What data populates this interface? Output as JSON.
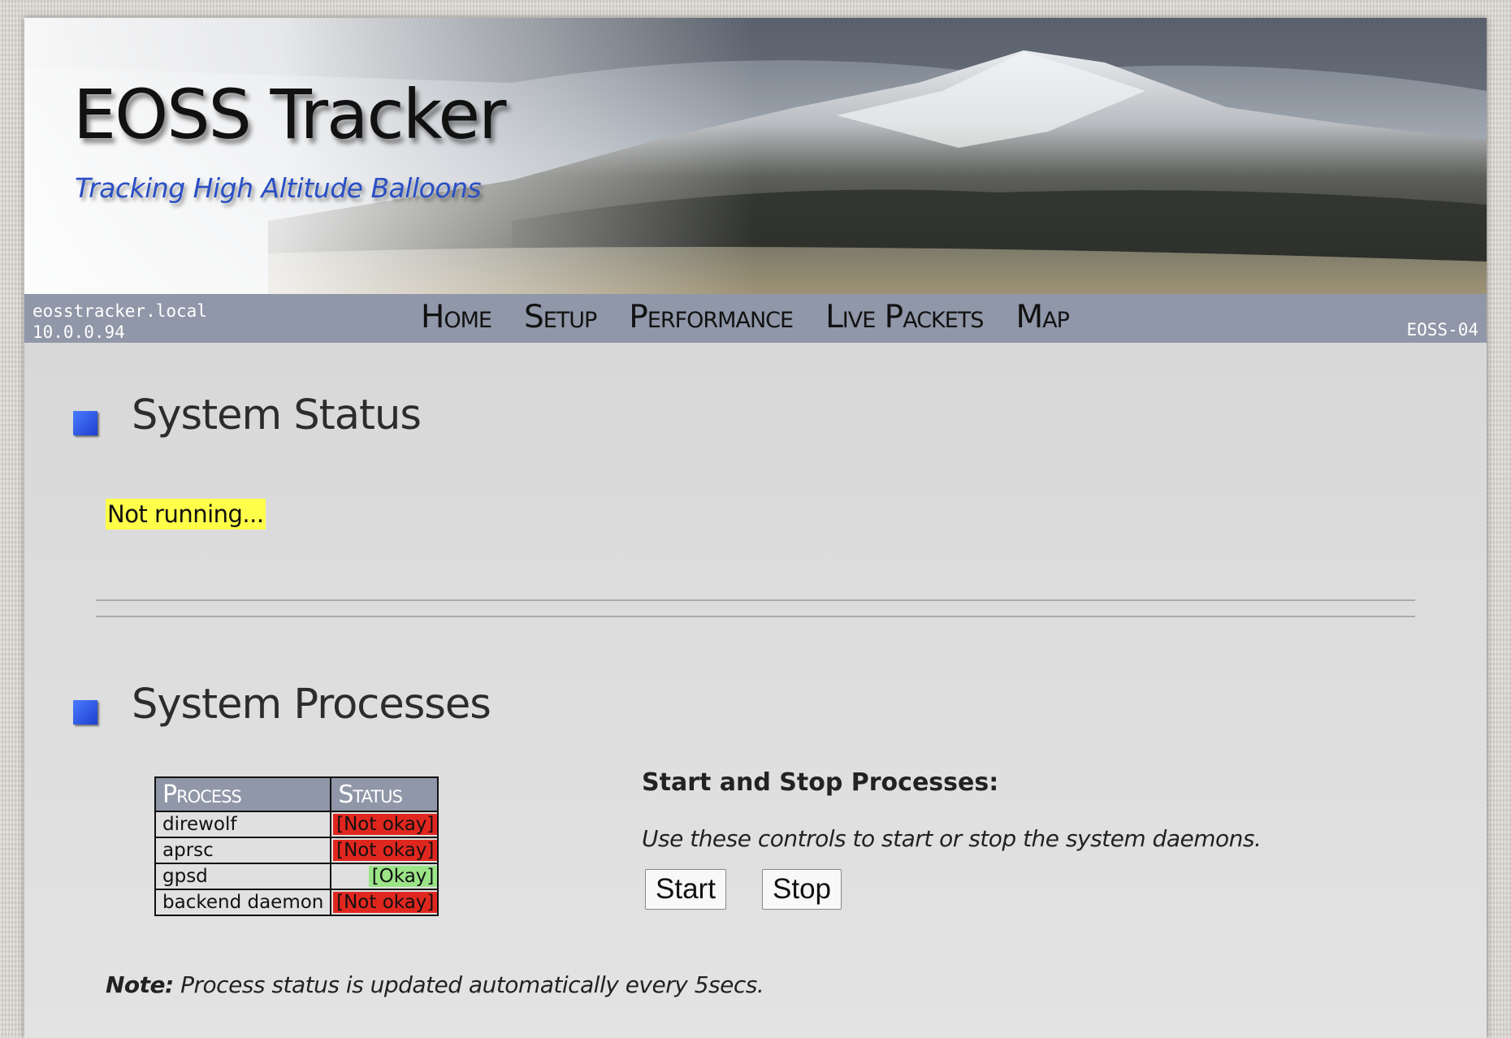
{
  "header": {
    "title": "EOSS Tracker",
    "subtitle": "Tracking High Altitude Balloons"
  },
  "navbar": {
    "hostname": "eosstracker.local",
    "ip": "10.0.0.94",
    "callsign": "EOSS-04",
    "items": [
      {
        "label": "Home"
      },
      {
        "label": "Setup"
      },
      {
        "label": "Performance"
      },
      {
        "label": "Live Packets"
      },
      {
        "label": "Map"
      }
    ]
  },
  "system_status": {
    "heading": "System Status",
    "message": "Not running..."
  },
  "system_processes": {
    "heading": "System Processes",
    "columns": [
      "Process",
      "Status"
    ],
    "rows": [
      {
        "process": "direwolf",
        "status": "[Not okay]",
        "state": "bad"
      },
      {
        "process": "aprsc",
        "status": "[Not okay]",
        "state": "bad"
      },
      {
        "process": "gpsd",
        "status": "[Okay]",
        "state": "ok"
      },
      {
        "process": "backend daemon",
        "status": "[Not okay]",
        "state": "bad"
      }
    ],
    "controls": {
      "heading": "Start and Stop Processes:",
      "description": "Use these controls to start or stop the system daemons.",
      "start_label": "Start",
      "stop_label": "Stop"
    },
    "note_label": "Note:",
    "note_text": " Process status is updated automatically every 5secs."
  },
  "colors": {
    "accent_blue": "#2a4fc4",
    "nav_bg": "#8f97a8",
    "status_bad": "#e0271f",
    "status_ok": "#9be488",
    "warning_bg": "#ffff4a"
  }
}
